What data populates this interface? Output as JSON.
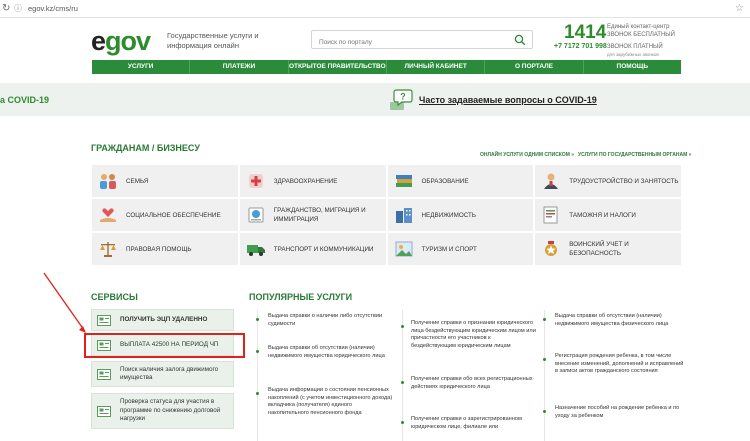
{
  "browser": {
    "url": "egov.kz/cms/ru"
  },
  "header": {
    "logo_e": "e",
    "logo_gov": "gov",
    "tagline": "Государственные услуги и информация онлайн",
    "search_placeholder": "Поиск по порталу",
    "phone_short": "1414",
    "phone_short_desc": "Единый контакт-центр ЗВОНОК БЕСПЛАТНЫЙ",
    "phone_long": "+7 7172 701 998",
    "phone_long_desc": "ЗВОНОК ПЛАТНЫЙ",
    "phone_long_note": "для зарубежных звонков"
  },
  "nav": [
    "УСЛУГИ",
    "ПЛАТЕЖИ",
    "ОТКРЫТОЕ ПРАВИТЕЛЬСТВО",
    "ЛИЧНЫЙ КАБИНЕТ",
    "О ПОРТАЛЕ",
    "ПОМОЩЬ"
  ],
  "covid": {
    "left_text": "а COVID-19",
    "faq_text": "Часто задаваемые вопросы о COVID-19"
  },
  "citizens": {
    "title": "ГРАЖДАНАМ / БИЗНЕСУ",
    "link_list": "ОНЛАЙН УСЛУГИ ОДНИМ СПИСКОМ »",
    "link_orgs": "УСЛУГИ ПО ГОСУДАРСТВЕННЫМ ОРГАНАМ »",
    "categories": [
      {
        "label": "СЕМЬЯ",
        "icon": "family-icon"
      },
      {
        "label": "ЗДРАВООХРАНЕНИЕ",
        "icon": "health-icon"
      },
      {
        "label": "ОБРАЗОВАНИЕ",
        "icon": "books-icon"
      },
      {
        "label": "ТРУДОУСТРОЙСТВО И ЗАНЯТОСТЬ",
        "icon": "worker-icon"
      },
      {
        "label": "СОЦИАЛЬНОЕ ОБЕСПЕЧЕНИЕ",
        "icon": "social-care-icon"
      },
      {
        "label": "ГРАЖДАНСТВО, МИГРАЦИЯ И ИММИГРАЦИЯ",
        "icon": "migration-icon"
      },
      {
        "label": "НЕДВИЖИМОСТЬ",
        "icon": "buildings-icon"
      },
      {
        "label": "ТАМОЖНЯ И НАЛОГИ",
        "icon": "customs-icon"
      },
      {
        "label": "ПРАВОВАЯ ПОМОЩЬ",
        "icon": "scales-icon"
      },
      {
        "label": "ТРАНСПОРТ И КОММУНИКАЦИИ",
        "icon": "truck-icon"
      },
      {
        "label": "ТУРИЗМ И СПОРТ",
        "icon": "tourism-icon"
      },
      {
        "label": "ВОИНСКИЙ УЧЕТ И БЕЗОПАСНОСТЬ",
        "icon": "military-icon"
      }
    ]
  },
  "services": {
    "title": "СЕРВИСЫ",
    "items": [
      "ПОЛУЧИТЬ ЭЦП УДАЛЕННО",
      "ВЫПЛАТА 42500 НА ПЕРИОД ЧП",
      "Поиск наличия залога движимого имущества",
      "Проверка статуса для участия в программе по снижению долговой нагрузки"
    ]
  },
  "popular": {
    "title": "ПОПУЛЯРНЫЕ УСЛУГИ",
    "col1": [
      "Выдача справки о наличии либо отсутствии судимости",
      "Выдача справки об отсутствии (наличии) недвижимого имущества юридического лица",
      "Выдача информации о состоянии пенсионных накоплений (с учетом инвестиционного дохода) вкладчика (получателя) единого накопительного пенсионного фонда"
    ],
    "col2": [
      "Получение справки о признании юридического лица бездействующим юридическим лицом или причастности его участников к бездействующим юридическим лицам",
      "Получение справки обо всех регистрационных действиях юридического лица",
      "Получение справки о зарегистрированном юридическом лице, филиале или"
    ],
    "col3": [
      "Выдача справки об отсутствии (наличии) недвижимого имущества физического лица",
      "Регистрация рождения ребенка, в том числе внесение изменений, дополнений и исправлений в записи актов гражданского состояния",
      "Назначение пособий на рождение ребенка и по уходу за ребенком"
    ]
  }
}
